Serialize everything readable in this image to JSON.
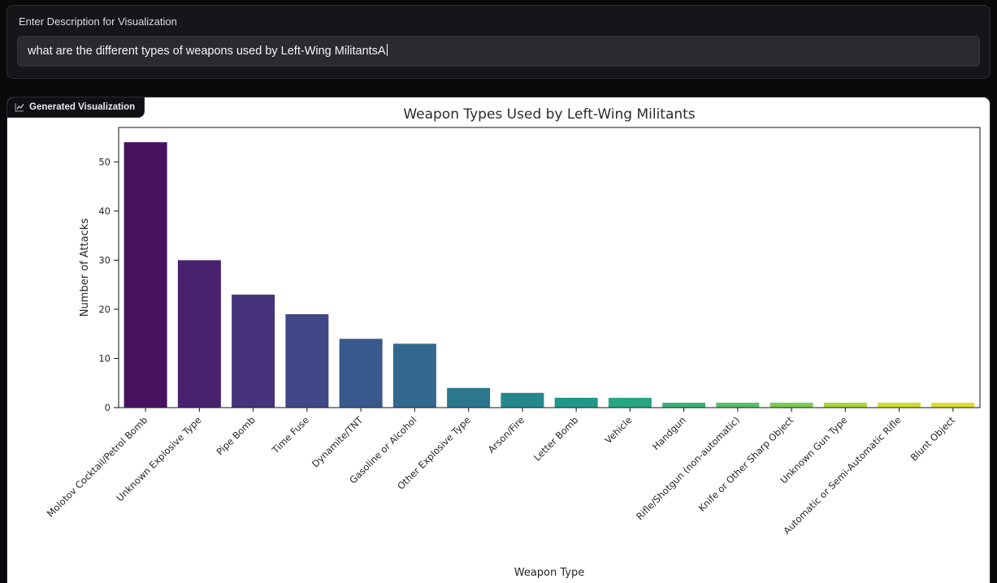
{
  "form": {
    "label": "Enter Description for Visualization",
    "input_value": "what are the different types of weapons used by Left-Wing MilitantsA"
  },
  "output": {
    "badge_label": "Generated Visualization"
  },
  "theme": {
    "page_bg": "#0a0a0d",
    "panel_bg": "#16161a",
    "input_bg": "#2b2b2f",
    "chart_bg": "#ffffff",
    "text_light": "#ececf0"
  },
  "chart_data": {
    "type": "bar",
    "title": "Weapon Types Used by Left-Wing Militants",
    "xlabel": "Weapon Type",
    "ylabel": "Number of Attacks",
    "ylim": [
      0,
      57
    ],
    "yticks": [
      0,
      10,
      20,
      30,
      40,
      50
    ],
    "grid": false,
    "legend": "none",
    "palette": "viridis",
    "categories": [
      "Molotov Cocktail/Petrol Bomb",
      "Unknown Explosive Type",
      "Pipe Bomb",
      "Time Fuse",
      "Dynamite/TNT",
      "Gasoline or Alcohol",
      "Other Explosive Type",
      "Arson/Fire",
      "Letter Bomb",
      "Vehicle",
      "Handgun",
      "Rifle/Shotgun (non-automatic)",
      "Knife or Other Sharp Object",
      "Unknown Gun Type",
      "Automatic or Semi-Automatic Rifle",
      "Blunt Object"
    ],
    "values": [
      54,
      30,
      23,
      19,
      14,
      13,
      4,
      3,
      2,
      2,
      1,
      1,
      1,
      1,
      1,
      1
    ],
    "bar_colors": [
      "#46125e",
      "#48226e",
      "#47337c",
      "#414786",
      "#39588b",
      "#32688d",
      "#2b788d",
      "#25878d",
      "#20968a",
      "#27a583",
      "#3bb277",
      "#57c067",
      "#7ccb50",
      "#a7d53b",
      "#cfdd2c",
      "#dcdd30"
    ]
  }
}
